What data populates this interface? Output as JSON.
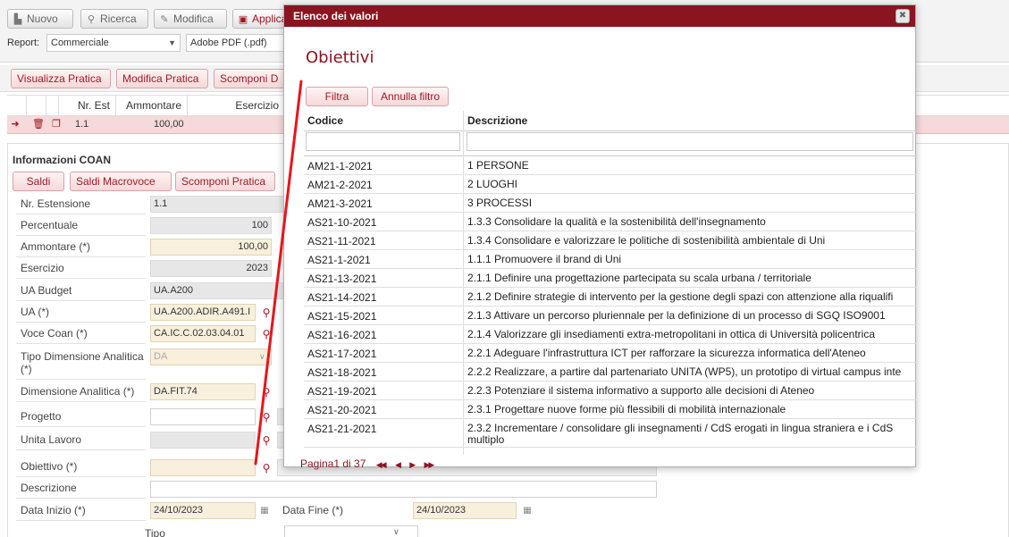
{
  "toolbar": {
    "nuovo": "Nuovo",
    "ricerca": "Ricerca",
    "modifica": "Modifica",
    "applica": "Applica"
  },
  "report": {
    "label": "Report:",
    "value": "Commerciale",
    "format": "Adobe PDF (.pdf)"
  },
  "actions": {
    "visualizza": "Visualizza Pratica",
    "modifica": "Modifica Pratica",
    "scomponi": "Scomponi D"
  },
  "grid": {
    "headers": [
      "Nr. Est",
      "Ammontare",
      "Esercizio"
    ],
    "row": [
      "1.1",
      "100,00"
    ]
  },
  "coan": {
    "title": "Informazioni COAN",
    "btn_saldi": "Saldi",
    "btn_saldi_macro": "Saldi Macrovoce",
    "btn_scomponi": "Scomponi Pratica",
    "fields": {
      "nr_estensione": {
        "label": "Nr. Estensione",
        "value": "1.1"
      },
      "percentuale": {
        "label": "Percentuale",
        "value": "100"
      },
      "ammontare": {
        "label": "Ammontare (*)",
        "value": "100,00"
      },
      "esercizio": {
        "label": "Esercizio",
        "value": "2023"
      },
      "ua_budget": {
        "label": "UA Budget",
        "value": "UA.A200"
      },
      "ua": {
        "label": "UA (*)",
        "value": "UA.A200.ADIR.A491.I"
      },
      "voce_coan": {
        "label": "Voce Coan (*)",
        "value": "CA.IC.C.02.03.04.01"
      },
      "tipo_dim": {
        "label": "Tipo Dimensione Analitica (*)",
        "value": "DA"
      },
      "dimensione": {
        "label": "Dimensione Analitica (*)",
        "value": "DA.FIT.74"
      },
      "progetto": {
        "label": "Progetto",
        "value": ""
      },
      "unita_lavoro": {
        "label": "Unita Lavoro",
        "value": ""
      },
      "obiettivo": {
        "label": "Obiettivo (*)",
        "value": ""
      },
      "descrizione": {
        "label": "Descrizione",
        "value": ""
      },
      "data_inizio": {
        "label": "Data Inizio (*)",
        "value": "24/10/2023"
      },
      "data_fine": {
        "label": "Data Fine (*)",
        "value": "24/10/2023"
      },
      "tipo": {
        "label": "Tipo",
        "value": ""
      }
    }
  },
  "modal": {
    "title": "Elenco dei valori",
    "heading": "Obiettivi",
    "filtra": "Filtra",
    "annulla": "Annulla filtro",
    "col_codice": "Codice",
    "col_descrizione": "Descrizione",
    "rows": [
      {
        "code": "AM21-1-2021",
        "desc": "1 PERSONE"
      },
      {
        "code": "AM21-2-2021",
        "desc": "2 LUOGHI"
      },
      {
        "code": "AM21-3-2021",
        "desc": "3 PROCESSI"
      },
      {
        "code": "AS21-10-2021",
        "desc": "1.3.3 Consolidare la qualità e la sostenibilità dell'insegnamento"
      },
      {
        "code": "AS21-11-2021",
        "desc": "1.3.4 Consolidare e valorizzare le politiche di sostenibilità ambientale di Uni"
      },
      {
        "code": "AS21-1-2021",
        "desc": "1.1.1 Promuovere il brand di Uni"
      },
      {
        "code": "AS21-13-2021",
        "desc": "2.1.1 Definire una progettazione partecipata su scala urbana / territoriale"
      },
      {
        "code": "AS21-14-2021",
        "desc": "2.1.2 Definire strategie di intervento per la gestione degli spazi con attenzione alla riqualifi"
      },
      {
        "code": "AS21-15-2021",
        "desc": "2.1.3 Attivare un percorso pluriennale per la definizione di un processo di SGQ ISO9001"
      },
      {
        "code": "AS21-16-2021",
        "desc": "2.1.4 Valorizzare gli insediamenti extra-metropolitani in ottica di Università policentrica"
      },
      {
        "code": "AS21-17-2021",
        "desc": "2.2.1 Adeguare l'infrastruttura ICT per rafforzare la sicurezza informatica dell'Ateneo"
      },
      {
        "code": "AS21-18-2021",
        "desc": "2.2.2 Realizzare, a partire dal partenariato UNITA (WP5), un prototipo di virtual campus inte"
      },
      {
        "code": "AS21-19-2021",
        "desc": "2.2.3 Potenziare il sistema informativo a supporto alle decisioni di Ateneo"
      },
      {
        "code": "AS21-20-2021",
        "desc": "2.3.1 Progettare nuove forme più flessibili di mobilità internazionale"
      },
      {
        "code": "AS21-21-2021",
        "desc": "2.3.2 Incrementare / consolidare gli insegnamenti / CdS erogati in lingua straniera e i CdS multiplo"
      }
    ],
    "pager_label": "Pagina1 di 37",
    "pager_first": "first-page-icon",
    "pager_prev": "prev-page-icon",
    "pager_next": "next-page-icon",
    "pager_last": "last-page-icon"
  },
  "colors": {
    "brand": "#8a1520",
    "annotation": "#e8141c"
  }
}
